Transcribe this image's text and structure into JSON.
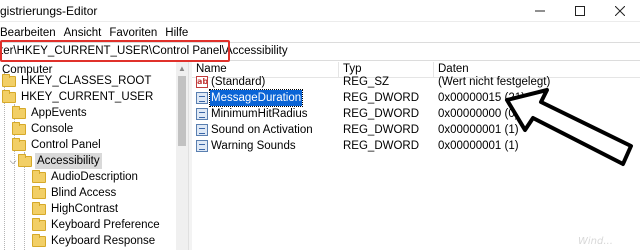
{
  "window": {
    "title": "gistrierungs-Editor",
    "buttons": {
      "minimize": "—",
      "maximize": "□",
      "close": "✕"
    }
  },
  "menu": {
    "items": [
      "Bearbeiten",
      "Ansicht",
      "Favoriten",
      "Hilfe"
    ]
  },
  "address": {
    "path": "ter\\HKEY_CURRENT_USER\\Control Panel\\Accessibility",
    "highlight_color": "#e0312b"
  },
  "tree": {
    "items": [
      {
        "label": "Computer"
      },
      {
        "label": "HKEY_CLASSES_ROOT"
      },
      {
        "label": "HKEY_CURRENT_USER"
      },
      {
        "label": "AppEvents"
      },
      {
        "label": "Console"
      },
      {
        "label": "Control Panel"
      },
      {
        "label": "Accessibility",
        "selected": true
      },
      {
        "label": "AudioDescription"
      },
      {
        "label": "Blind Access"
      },
      {
        "label": "HighContrast"
      },
      {
        "label": "Keyboard Preference"
      },
      {
        "label": "Keyboard Response"
      }
    ]
  },
  "list": {
    "columns": {
      "name": "Name",
      "type": "Typ",
      "data": "Daten"
    },
    "rows": [
      {
        "icon": "string-value-icon",
        "name": "(Standard)",
        "type": "REG_SZ",
        "data": "(Wert nicht festgelegt)"
      },
      {
        "icon": "dword-value-icon",
        "name": "MessageDuration",
        "type": "REG_DWORD",
        "data": "0x00000015 (21)",
        "selected": true
      },
      {
        "icon": "dword-value-icon",
        "name": "MinimumHitRadius",
        "type": "REG_DWORD",
        "data": "0x00000000 (0)"
      },
      {
        "icon": "dword-value-icon",
        "name": "Sound on Activation",
        "type": "REG_DWORD",
        "data": "0x00000001 (1)"
      },
      {
        "icon": "dword-value-icon",
        "name": "Warning Sounds",
        "type": "REG_DWORD",
        "data": "0x00000001 (1)"
      }
    ],
    "selection_color": "#0a64d6"
  },
  "watermark": "Wind...",
  "colors": {
    "folder": "#f2cf66",
    "tree_selection": "#d9d9d9"
  }
}
